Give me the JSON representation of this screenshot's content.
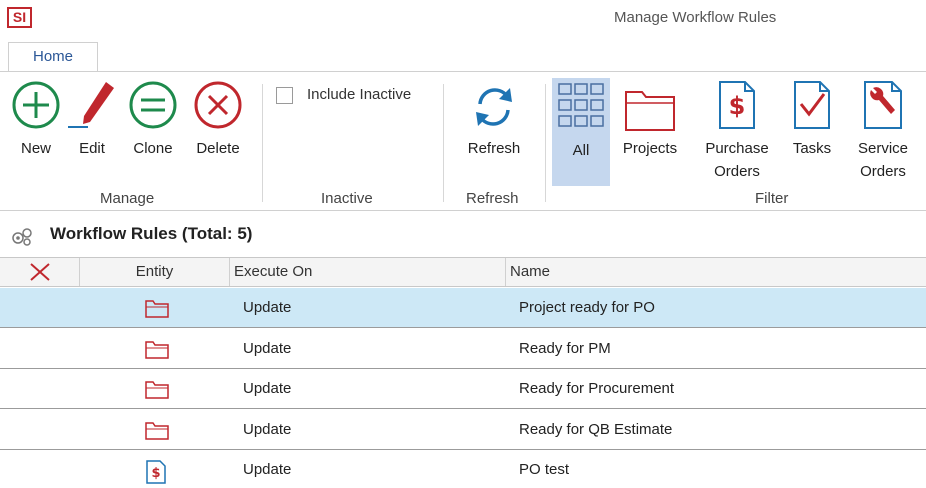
{
  "app": {
    "logo_text": "SI",
    "window_title": "Manage Workflow Rules"
  },
  "ribbon": {
    "tab_home": "Home",
    "manage": {
      "new": "New",
      "edit": "Edit",
      "clone": "Clone",
      "delete": "Delete",
      "group": "Manage"
    },
    "inactive": {
      "include_inactive": "Include Inactive",
      "include_inactive_checked": false,
      "group": "Inactive"
    },
    "refresh": {
      "label": "Refresh",
      "group": "Refresh"
    },
    "filter": {
      "all": "All",
      "projects": "Projects",
      "purchase_line1": "Purchase",
      "purchase_line2": "Orders",
      "tasks": "Tasks",
      "service_line1": "Service",
      "service_line2": "Orders",
      "group": "Filter",
      "selected": "All"
    }
  },
  "grid": {
    "title": "Workflow Rules (Total: 5)",
    "columns": [
      "Entity",
      "Execute On",
      "Name"
    ],
    "rows": [
      {
        "entity_icon": "folder-icon",
        "execute_on": "Update",
        "name": "Project ready for PO",
        "selected": true
      },
      {
        "entity_icon": "folder-icon",
        "execute_on": "Update",
        "name": "Ready for PM",
        "selected": false
      },
      {
        "entity_icon": "folder-icon",
        "execute_on": "Update",
        "name": "Ready for Procurement",
        "selected": false
      },
      {
        "entity_icon": "folder-icon",
        "execute_on": "Update",
        "name": "Ready for QB Estimate",
        "selected": false
      },
      {
        "entity_icon": "purchase-order-icon",
        "execute_on": "Update",
        "name": "PO test",
        "selected": false
      }
    ]
  },
  "colors": {
    "accent_green": "#1e8a4c",
    "accent_red": "#c0272d",
    "accent_blue": "#1f74b3",
    "selected_row": "#cde8f6",
    "selected_filter": "#c5d7ee"
  }
}
